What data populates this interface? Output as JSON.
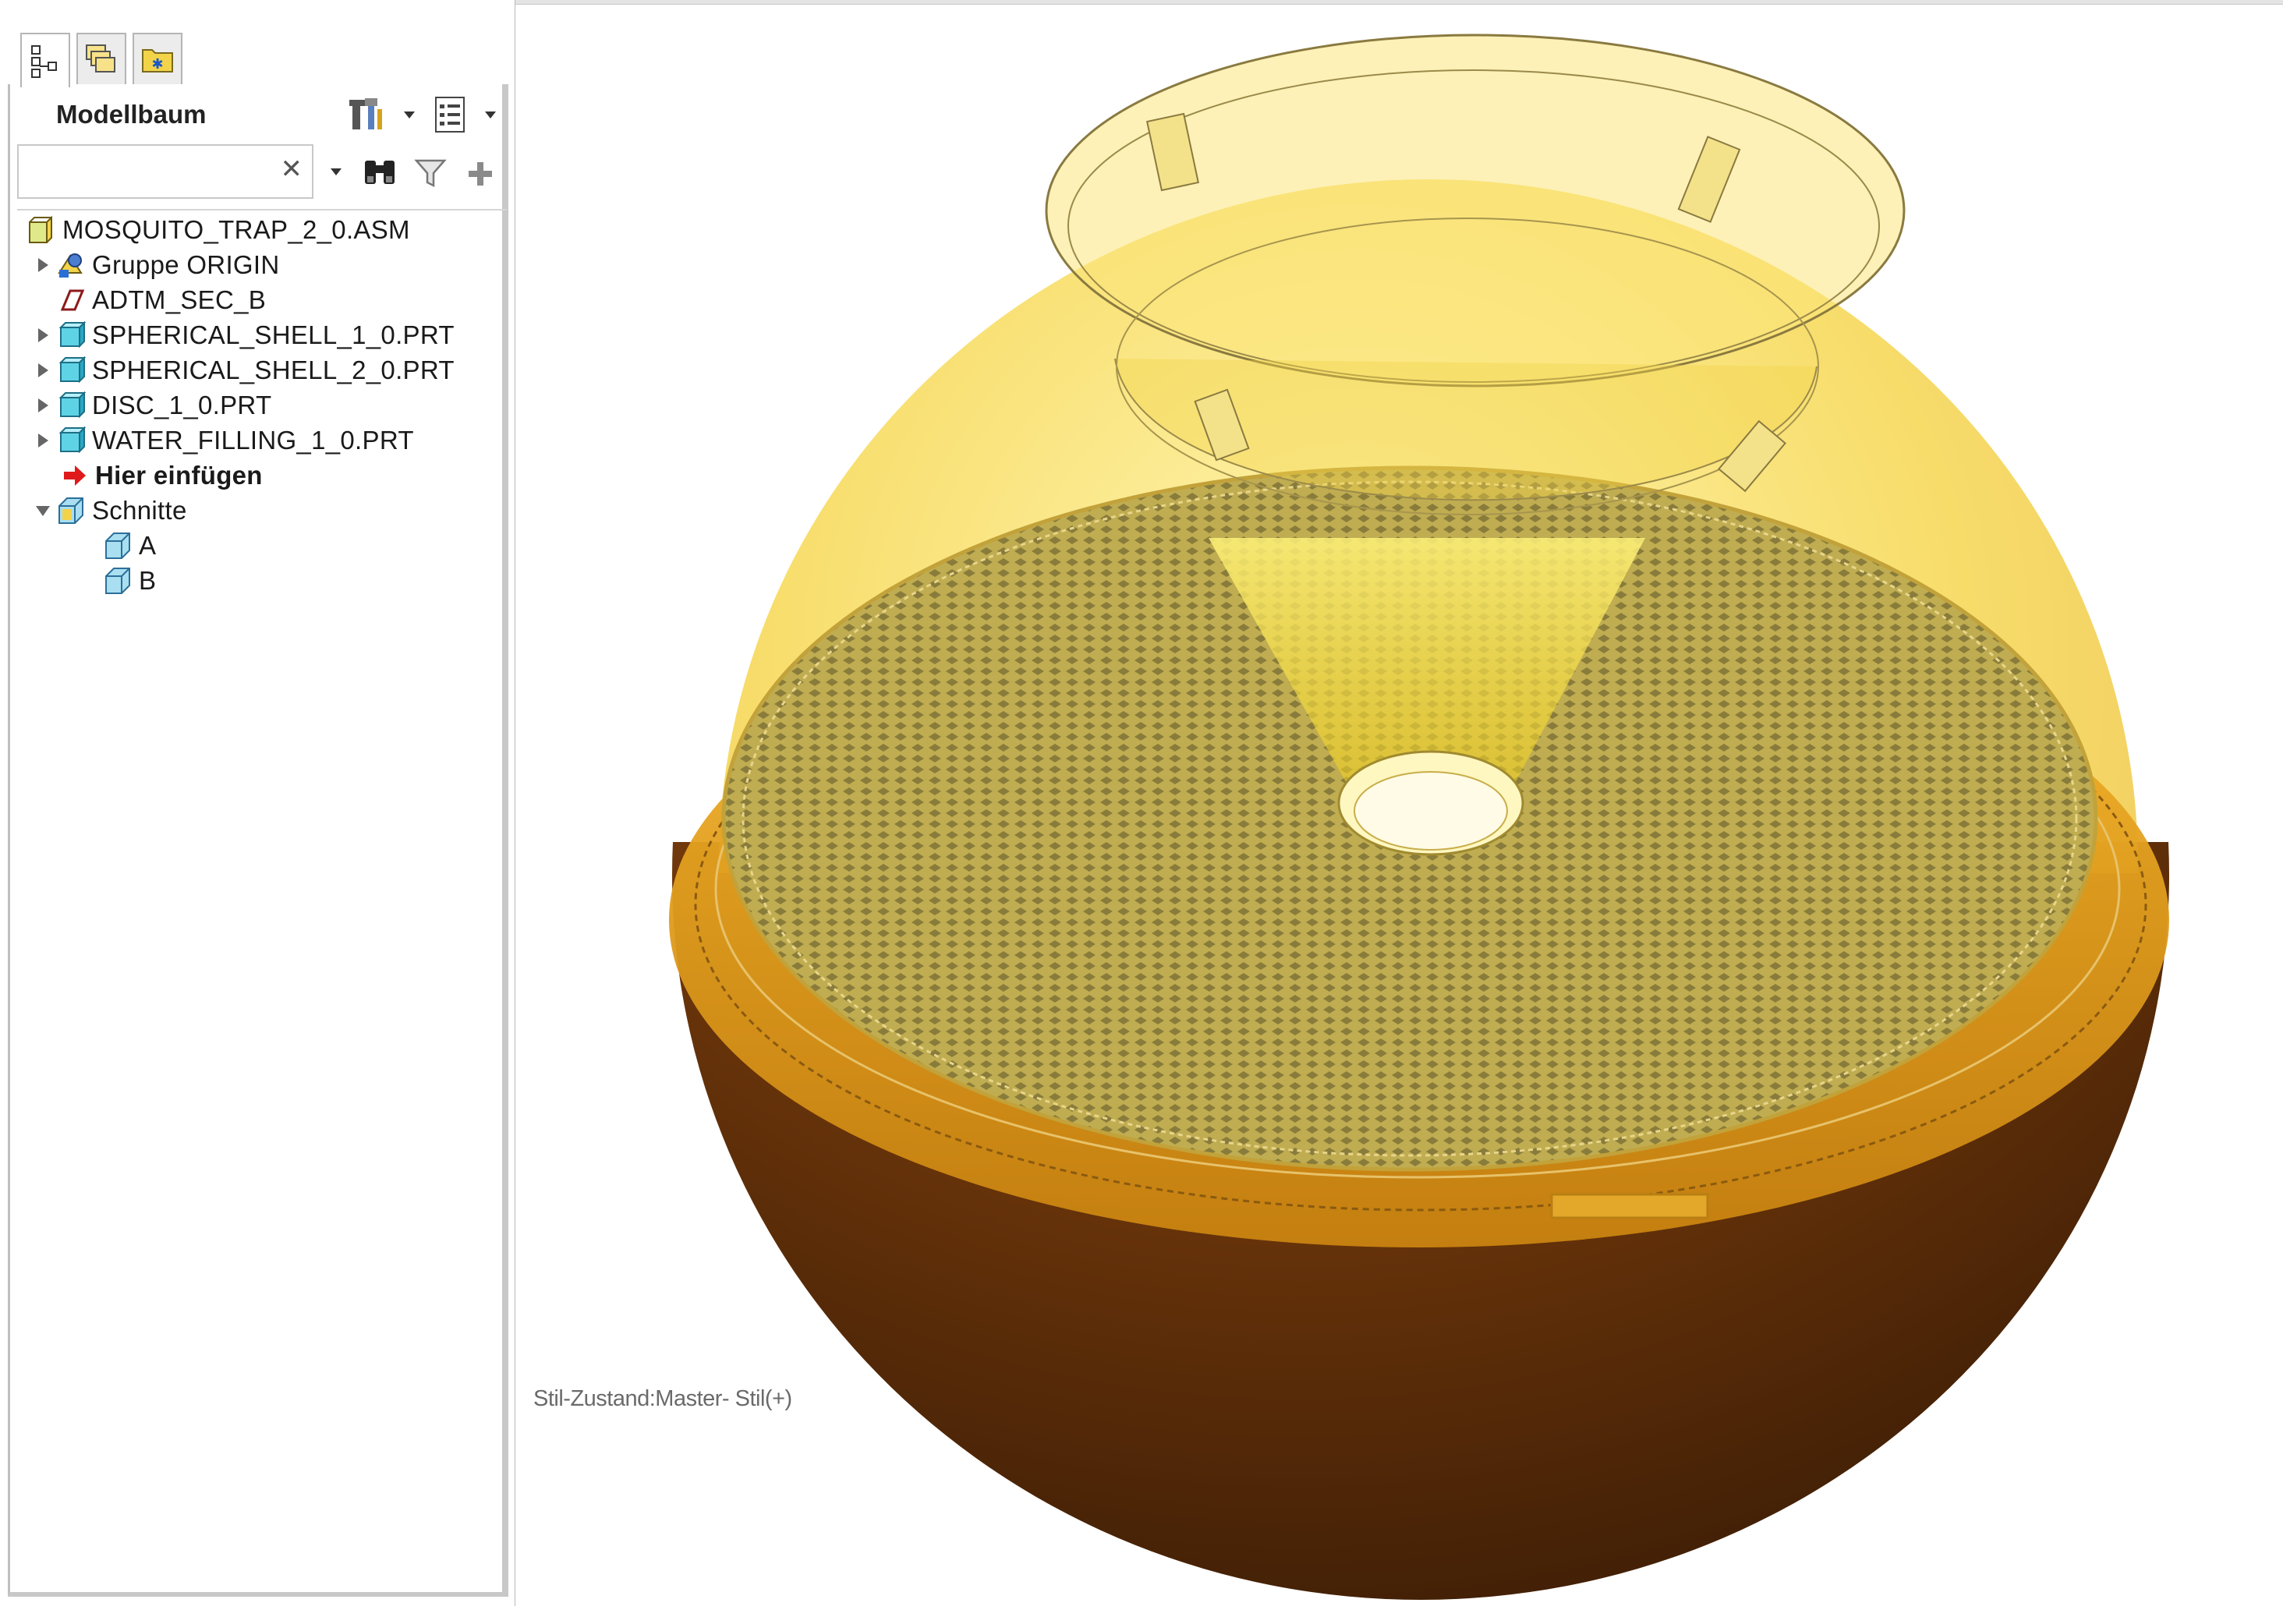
{
  "sidebar": {
    "tabs": [
      {
        "name": "model-tree-tab",
        "icon": "model-tree-icon",
        "active": true
      },
      {
        "name": "layers-tab",
        "icon": "layers-icon",
        "active": false
      },
      {
        "name": "favorites-tab",
        "icon": "folder-star-icon",
        "active": false
      }
    ],
    "title": "Modellbaum",
    "toolbar_icons": [
      "settings-tools-icon",
      "tree-columns-icon"
    ],
    "search": {
      "value": "",
      "placeholder": ""
    },
    "search_tools": [
      "binoculars-icon",
      "filter-icon",
      "add-icon"
    ],
    "tree": [
      {
        "label": "MOSQUITO_TRAP_2_0.ASM",
        "icon": "assembly-icon",
        "expander": "none"
      },
      {
        "label": "Gruppe ORIGIN",
        "icon": "group-icon",
        "expander": "collapsed"
      },
      {
        "label": "ADTM_SEC_B",
        "icon": "datum-plane-icon",
        "expander": "none"
      },
      {
        "label": "SPHERICAL_SHELL_1_0.PRT",
        "icon": "part-icon",
        "expander": "collapsed"
      },
      {
        "label": "SPHERICAL_SHELL_2_0.PRT",
        "icon": "part-icon",
        "expander": "collapsed"
      },
      {
        "label": "DISC_1_0.PRT",
        "icon": "part-icon",
        "expander": "collapsed"
      },
      {
        "label": "WATER_FILLING_1_0.PRT",
        "icon": "part-icon",
        "expander": "collapsed"
      },
      {
        "label": "Hier einfügen",
        "icon": "insert-here-arrow-icon",
        "expander": "none"
      },
      {
        "label": "Schnitte",
        "icon": "sections-icon",
        "expander": "expanded"
      },
      {
        "label": "A",
        "icon": "section-icon",
        "expander": "none"
      },
      {
        "label": "B",
        "icon": "section-icon",
        "expander": "none"
      }
    ]
  },
  "viewport": {
    "status": "Stil-Zustand:Master- Stil(+)",
    "colors": {
      "shell_top": "#f5d23a",
      "shell_bottom": "#7a3d0c",
      "disc": "#b5a24a",
      "rim": "#e8a313"
    }
  }
}
